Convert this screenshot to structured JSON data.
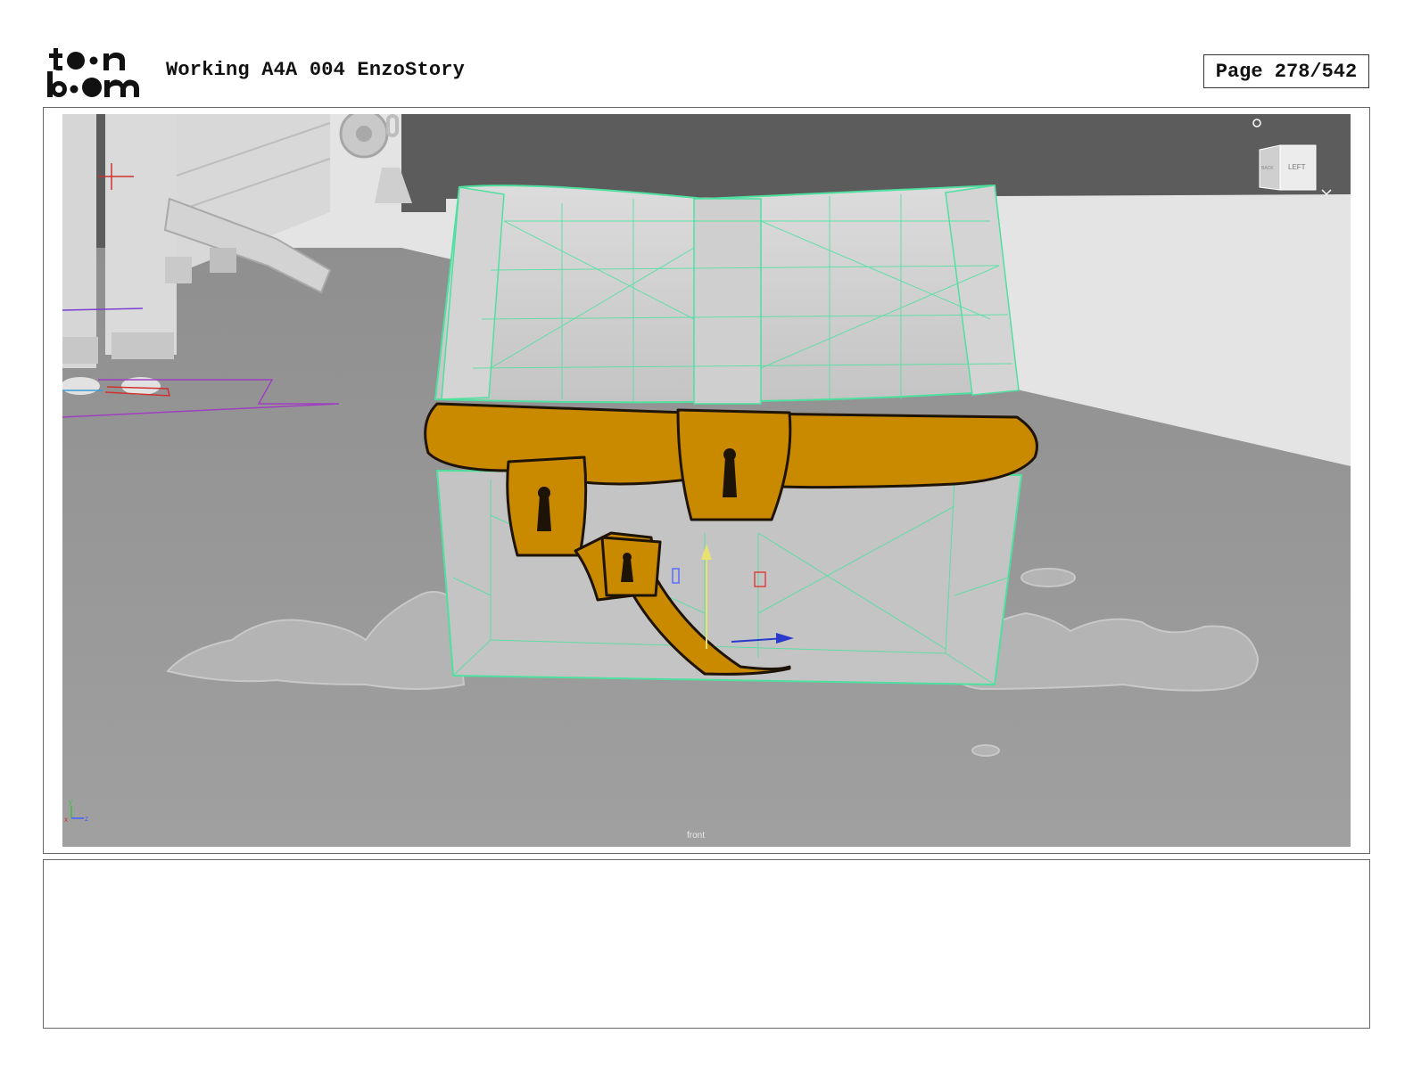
{
  "header": {
    "logo_text_top": "toon",
    "logo_text_bottom": "boom",
    "project_title": "Working A4A 004 EnzoStory",
    "page_label": "Page 278/542"
  },
  "viewport": {
    "camera_label": "front",
    "viewcube": {
      "left_face": "LEFT",
      "back_face": "BACK"
    },
    "colors": {
      "sky": "#5c5c5c",
      "wall": "#e4e4e4",
      "floor": "#9b9b9b",
      "wireframe": "#4fe0a0",
      "strap": "#c98a00",
      "outline": "#1e1307"
    }
  },
  "caption": {
    "text": ""
  }
}
